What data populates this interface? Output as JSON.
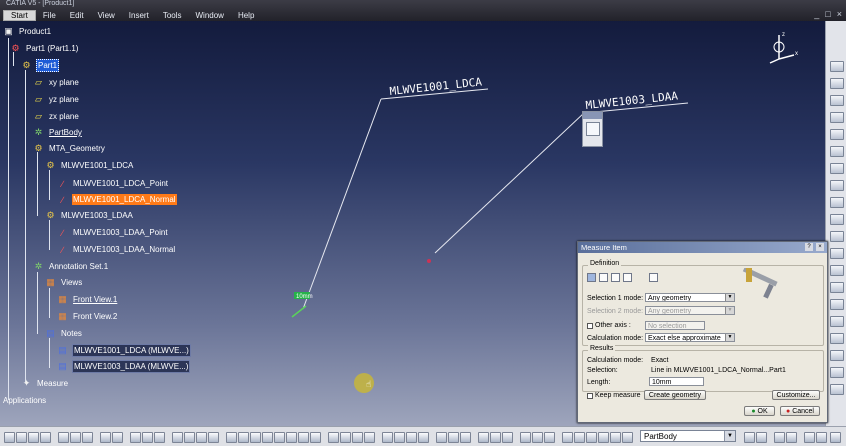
{
  "window": {
    "title": "CATIA V5 - [Product1]",
    "controls": [
      "_",
      "□",
      "×"
    ]
  },
  "menu": [
    "Start",
    "File",
    "Edit",
    "View",
    "Insert",
    "Tools",
    "Window",
    "Help"
  ],
  "tree": {
    "product": "Product1",
    "part_instance": "Part1 (Part1.1)",
    "part": "Part1",
    "xy_plane": "xy plane",
    "yz_plane": "yz plane",
    "zx_plane": "zx plane",
    "partbody": "PartBody",
    "geom_set": "MTA_Geometry",
    "set1": "MLWVE1001_LDCA",
    "set1_point": "MLWVE1001_LDCA_Point",
    "set1_normal": "MLWVE1001_LDCA_Normal",
    "set2": "MLWVE1003_LDAA",
    "set2_point": "MLWVE1003_LDAA_Point",
    "set2_normal": "MLWVE1003_LDAA_Normal",
    "annotation_set": "Annotation Set.1",
    "views": "Views",
    "front_view_1": "Front View.1",
    "front_view_2": "Front View.2",
    "notes": "Notes",
    "note1": "MLWVE1001_LDCA (MLWVE...)",
    "note2": "MLWVE1003_LDAA (MLWVE...)",
    "measure": "Measure",
    "applications": "Applications"
  },
  "viewport": {
    "label1": "MLWVE1001_LDCA",
    "label2": "MLWVE1003_LDAA",
    "measure_tag": "10mm"
  },
  "dialog": {
    "title": "Measure Item",
    "help": "?",
    "close": "×",
    "definition": "Definition",
    "sel1_label": "Selection 1 mode:",
    "sel1_value": "Any geometry",
    "sel2_label": "Selection 2 mode:",
    "sel2_value": "Any geometry",
    "other_axis": "Other axis :",
    "no_selection": "No selection",
    "calc_label": "Calculation mode:",
    "calc_value": "Exact else approximate",
    "results": "Results",
    "res_calc_label": "Calculation mode:",
    "res_calc_value": "Exact",
    "res_sel_label": "Selection:",
    "res_sel_value": "Line in MLWVE1001_LDCA_Normal...Part1",
    "length_label": "Length:",
    "length_value": "10mm",
    "keep_measure": "Keep measure",
    "create_geometry": "Create geometry",
    "customize": "Customize...",
    "ok": "OK",
    "cancel": "Cancel"
  },
  "bottom_toolbar": {
    "combo_value": "PartBody"
  }
}
